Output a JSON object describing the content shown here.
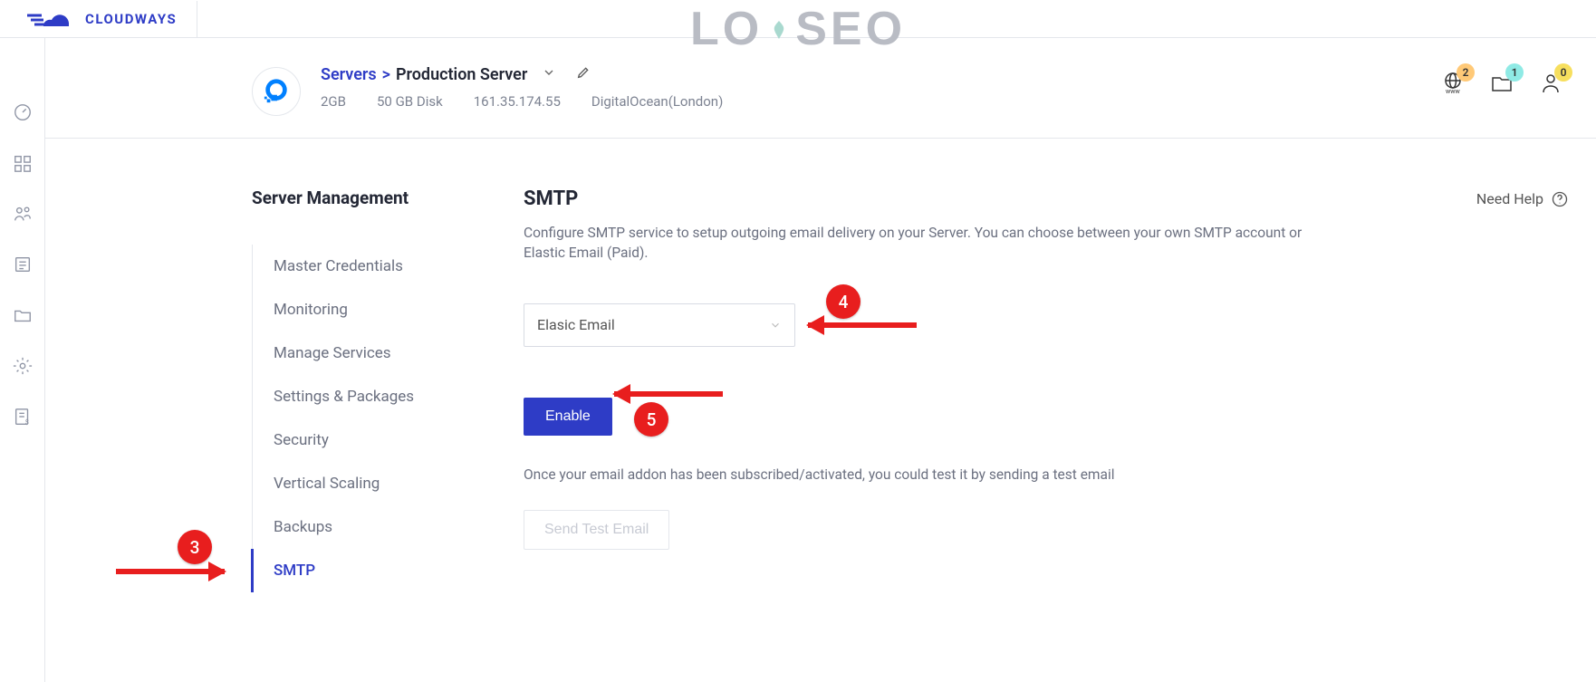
{
  "brand": {
    "name": "CLOUDWAYS"
  },
  "watermark": {
    "left": "LO",
    "right": "SEO"
  },
  "breadcrumb": {
    "root": "Servers",
    "sep": ">",
    "current": "Production Server"
  },
  "server_stats": {
    "ram": "2GB",
    "disk": "50 GB Disk",
    "ip": "161.35.174.55",
    "provider": "DigitalOcean(London)"
  },
  "header_badges": {
    "www": "2",
    "project": "1",
    "user": "0"
  },
  "sidebar": {
    "title": "Server Management",
    "items": [
      {
        "label": "Master Credentials"
      },
      {
        "label": "Monitoring"
      },
      {
        "label": "Manage Services"
      },
      {
        "label": "Settings & Packages"
      },
      {
        "label": "Security"
      },
      {
        "label": "Vertical Scaling"
      },
      {
        "label": "Backups"
      },
      {
        "label": "SMTP",
        "active": true
      }
    ]
  },
  "smtp": {
    "title": "SMTP",
    "help": "Need Help",
    "description": "Configure SMTP service to setup outgoing email delivery on your Server. You can choose between your own SMTP account or Elastic Email (Paid).",
    "select_value": "Elasic Email",
    "enable_label": "Enable",
    "note": "Once your email addon has been subscribed/activated, you could test it by sending a test email",
    "test_label": "Send Test Email"
  },
  "steps": {
    "s3": "3",
    "s4": "4",
    "s5": "5"
  }
}
